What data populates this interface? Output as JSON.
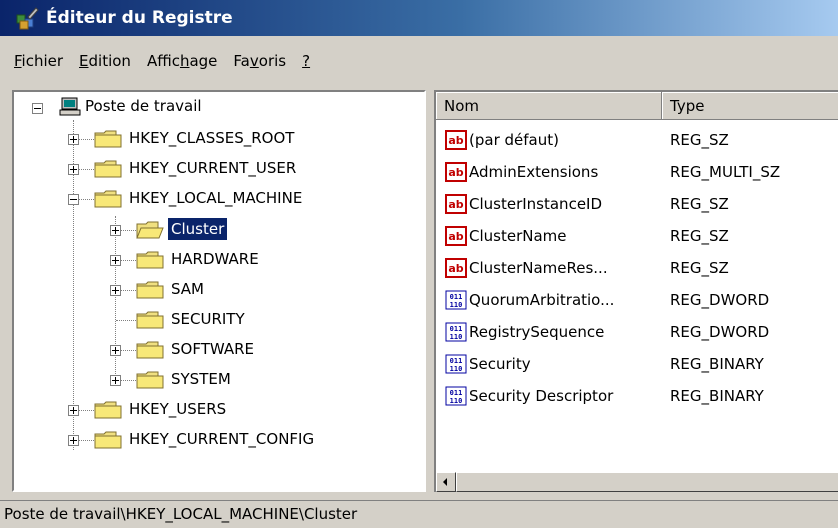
{
  "window": {
    "title": "Éditeur du Registre",
    "icon": "regedit-icon"
  },
  "menu": [
    {
      "label_u": "F",
      "label_rest": "ichier"
    },
    {
      "label_u": "E",
      "label_rest": "dition"
    },
    {
      "label_pre": "Affic",
      "label_u": "h",
      "label_rest": "age"
    },
    {
      "label_pre": "Fa",
      "label_u": "v",
      "label_rest": "oris"
    },
    {
      "label_u": "?",
      "label_rest": ""
    }
  ],
  "tree": {
    "root": "Poste de travail",
    "hives": [
      "HKEY_CLASSES_ROOT",
      "HKEY_CURRENT_USER",
      "HKEY_LOCAL_MACHINE",
      "HKEY_USERS",
      "HKEY_CURRENT_CONFIG"
    ],
    "local_machine_children": [
      "Cluster",
      "HARDWARE",
      "SAM",
      "SECURITY",
      "SOFTWARE",
      "SYSTEM"
    ],
    "selected": "Cluster"
  },
  "list": {
    "columns": [
      "Nom",
      "Type"
    ],
    "rows": [
      {
        "name": "(par défaut)",
        "type": "REG_SZ",
        "icon": "string-value-icon"
      },
      {
        "name": "AdminExtensions",
        "type": "REG_MULTI_SZ",
        "icon": "string-value-icon"
      },
      {
        "name": "ClusterInstanceID",
        "type": "REG_SZ",
        "icon": "string-value-icon"
      },
      {
        "name": "ClusterName",
        "type": "REG_SZ",
        "icon": "string-value-icon"
      },
      {
        "name": "ClusterNameRes...",
        "type": "REG_SZ",
        "icon": "string-value-icon"
      },
      {
        "name": "QuorumArbitratio...",
        "type": "REG_DWORD",
        "icon": "binary-value-icon"
      },
      {
        "name": "RegistrySequence",
        "type": "REG_DWORD",
        "icon": "binary-value-icon"
      },
      {
        "name": "Security",
        "type": "REG_BINARY",
        "icon": "binary-value-icon"
      },
      {
        "name": "Security Descriptor",
        "type": "REG_BINARY",
        "icon": "binary-value-icon"
      }
    ]
  },
  "status": {
    "path": "Poste de travail\\HKEY_LOCAL_MACHINE\\Cluster"
  },
  "colors": {
    "title_start": "#0a246a",
    "title_end": "#a6caf0",
    "selection": "#0a246a",
    "face": "#d4d0c8"
  }
}
